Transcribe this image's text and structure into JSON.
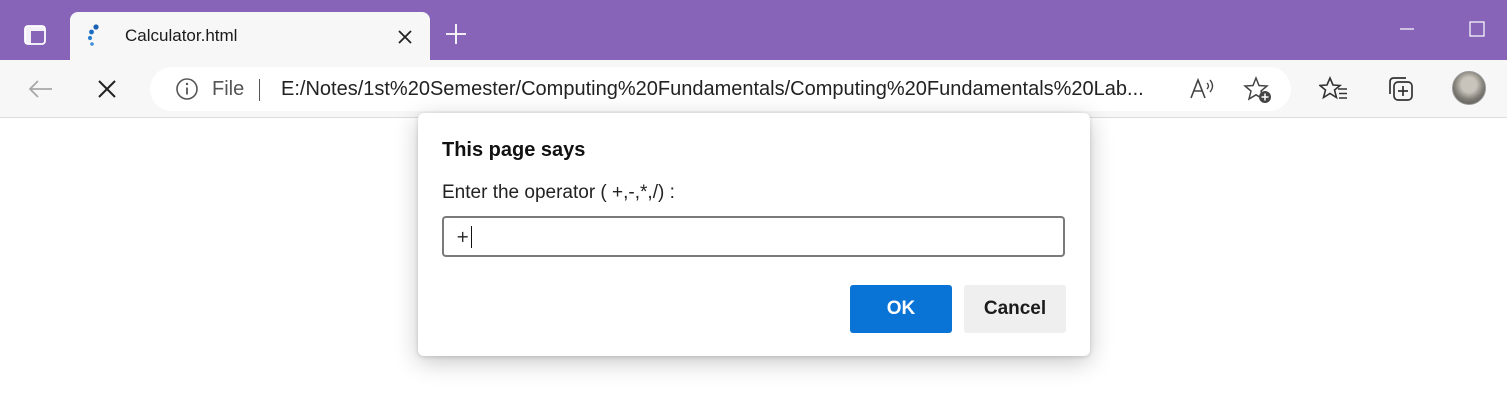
{
  "browser": {
    "tab": {
      "title": "Calculator.html"
    },
    "address": {
      "scheme_label": "File",
      "url": "E:/Notes/1st%20Semester/Computing%20Fundamentals/Computing%20Fundamentals%20Lab..."
    },
    "colors": {
      "titlebar": "#8764b8",
      "toolbar": "#f7f7f7",
      "accent": "#0a73d6"
    },
    "icons": [
      "tab-actions-icon",
      "loading-favicon-icon",
      "close-icon",
      "plus-icon",
      "minimize-icon",
      "maximize-icon",
      "back-arrow-icon",
      "stop-icon",
      "info-icon",
      "read-aloud-icon",
      "add-favorite-icon",
      "favorites-icon",
      "collections-icon",
      "profile-avatar"
    ]
  },
  "dialog": {
    "title": "This page says",
    "message": "Enter the operator ( +,-,*,/) :",
    "input_value": "+",
    "ok_label": "OK",
    "cancel_label": "Cancel"
  }
}
